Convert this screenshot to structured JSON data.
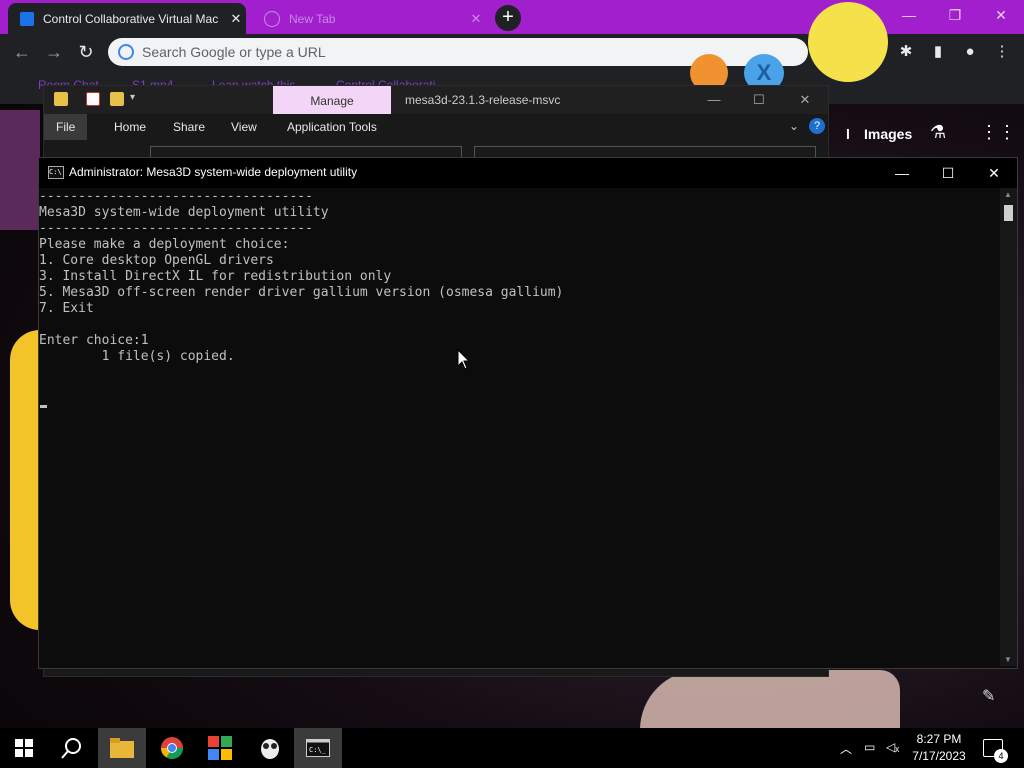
{
  "chrome": {
    "tabs": [
      {
        "title": "Control Collaborative Virtual Mac"
      },
      {
        "title": "New Tab"
      }
    ],
    "omnibox_placeholder": "Search Google or type a URL",
    "bookmarks": [
      "Room Chat",
      "S1.mp4",
      "Lean watch this",
      "Control Collaborati"
    ],
    "accent_color": "#a21fce"
  },
  "google_page": {
    "partial_link": "l",
    "images_label": "Images"
  },
  "explorer": {
    "manage_tab": "Manage",
    "title": "mesa3d-23.1.3-release-msvc",
    "ribbon_tabs": [
      "File",
      "Home",
      "Share",
      "View",
      "Application Tools"
    ]
  },
  "console": {
    "title": "Administrator:  Mesa3D system-wide deployment utility",
    "lines": [
      "-----------------------------------",
      "Mesa3D system-wide deployment utility",
      "-----------------------------------",
      "Please make a deployment choice:",
      "1. Core desktop OpenGL drivers",
      "3. Install DirectX IL for redistribution only",
      "5. Mesa3D off-screen render driver gallium version (osmesa gallium)",
      "7. Exit",
      "",
      "Enter choice:1",
      "        1 file(s) copied."
    ],
    "text_color": "#c0c0c0"
  },
  "taskbar": {
    "apps": [
      "start-icon",
      "search-icon",
      "file-explorer-icon",
      "chrome-icon",
      "photos-icon",
      "app-icon",
      "terminal-icon"
    ],
    "time": "8:27 PM",
    "date": "7/17/2023",
    "notification_count": "4"
  }
}
